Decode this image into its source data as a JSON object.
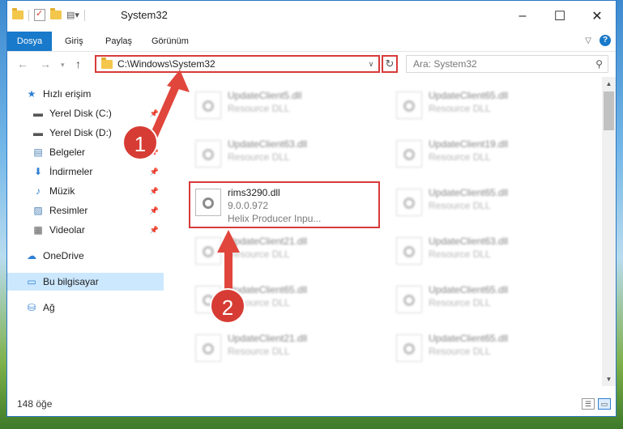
{
  "window": {
    "title": "System32",
    "controls": {
      "minimize": "–",
      "maximize": "☐",
      "close": "✕"
    }
  },
  "ribbon": {
    "tabs": [
      "Dosya",
      "Giriş",
      "Paylaş",
      "Görünüm"
    ]
  },
  "navigation": {
    "address": "C:\\Windows\\System32",
    "search_placeholder": "Ara: System32"
  },
  "sidebar": {
    "items": [
      {
        "label": "Hızlı erişim",
        "icon": "star-icon"
      },
      {
        "label": "Yerel Disk (C:)",
        "icon": "drive-icon",
        "pinned": true
      },
      {
        "label": "Yerel Disk (D:)",
        "icon": "drive-icon",
        "pinned": true
      },
      {
        "label": "Belgeler",
        "icon": "document-icon",
        "pinned": true
      },
      {
        "label": "İndirmeler",
        "icon": "download-icon",
        "pinned": true
      },
      {
        "label": "Müzik",
        "icon": "music-icon",
        "pinned": true
      },
      {
        "label": "Resimler",
        "icon": "pictures-icon",
        "pinned": true
      },
      {
        "label": "Videolar",
        "icon": "video-icon",
        "pinned": true
      },
      {
        "label": "OneDrive",
        "icon": "cloud-icon"
      },
      {
        "label": "Bu bilgisayar",
        "icon": "computer-icon",
        "selected": true
      },
      {
        "label": "Ağ",
        "icon": "network-icon"
      }
    ]
  },
  "files": {
    "left": [
      {
        "name": "UpdateClient5.dll",
        "type": "Resource DLL"
      },
      {
        "name": "UpdateClient63.dll",
        "type": "Resource DLL"
      },
      {
        "name": "rims3290.dll",
        "version": "9.0.0.972",
        "desc": "Helix Producer Inpu..."
      },
      {
        "name": "UpdateClient21.dll",
        "type": "Resource DLL"
      },
      {
        "name": "UpdateClient65.dll",
        "type": "Resource DLL"
      },
      {
        "name": "UpdateClient21.dll",
        "type": "Resource DLL"
      }
    ],
    "right": [
      {
        "name": "UpdateClient65.dll",
        "type": "Resource DLL"
      },
      {
        "name": "UpdateClient19.dll",
        "type": "Resource DLL"
      },
      {
        "name": "UpdateClient65.dll",
        "type": "Resource DLL"
      },
      {
        "name": "UpdateClient63.dll",
        "type": "Resource DLL"
      },
      {
        "name": "UpdateClient65.dll",
        "type": "Resource DLL"
      },
      {
        "name": "UpdateClient65.dll",
        "type": "Resource DLL"
      }
    ]
  },
  "status": {
    "count": "148 öğe"
  },
  "annotations": [
    "1",
    "2"
  ],
  "colors": {
    "accent": "#1979ca",
    "highlight": "#d83a3a",
    "arrow": "#e0463c"
  }
}
